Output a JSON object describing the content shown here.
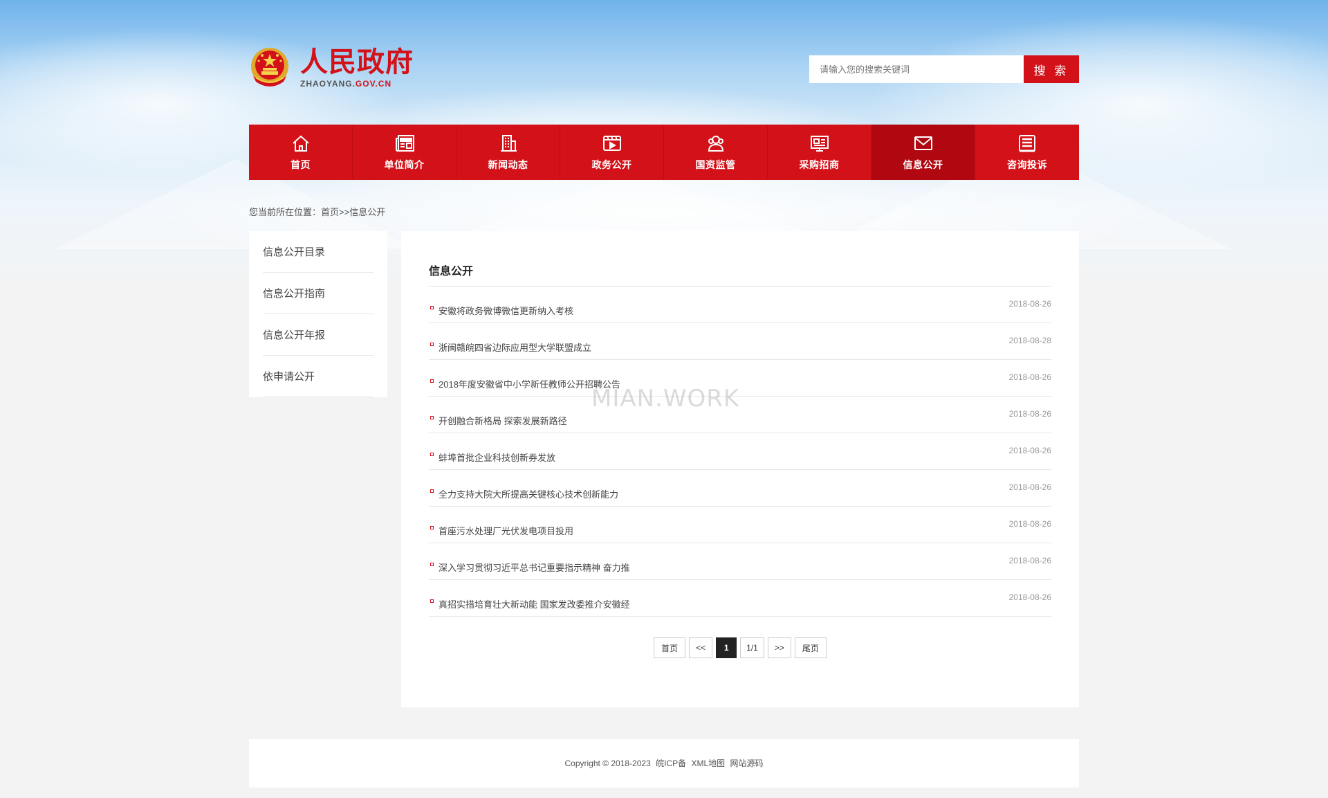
{
  "header": {
    "logo_title": "人民政府",
    "logo_domain_main": "ZHAOYANG.",
    "logo_domain_accent": "GOV.CN",
    "search_placeholder": "请输入您的搜索关键词",
    "search_button": "搜 索"
  },
  "nav": {
    "items": [
      {
        "label": "首页",
        "icon": "home-icon"
      },
      {
        "label": "单位简介",
        "icon": "news-icon"
      },
      {
        "label": "新闻动态",
        "icon": "building-icon"
      },
      {
        "label": "政务公开",
        "icon": "video-icon"
      },
      {
        "label": "国资监管",
        "icon": "users-icon"
      },
      {
        "label": "采购招商",
        "icon": "monitor-icon"
      },
      {
        "label": "信息公开",
        "icon": "mail-icon",
        "active": true
      },
      {
        "label": "咨询投诉",
        "icon": "document-icon"
      }
    ]
  },
  "breadcrumb": {
    "prefix": "您当前所在位置：",
    "home": "首页",
    "sep": ">>",
    "current": "信息公开"
  },
  "sidebar": {
    "items": [
      {
        "label": "信息公开目录"
      },
      {
        "label": "信息公开指南"
      },
      {
        "label": "信息公开年报"
      },
      {
        "label": "依申请公开"
      }
    ]
  },
  "main": {
    "title": "信息公开",
    "news": [
      {
        "title": "安徽将政务微博微信更新纳入考核",
        "date": "2018-08-26"
      },
      {
        "title": "浙闽赣皖四省边际应用型大学联盟成立",
        "date": "2018-08-28"
      },
      {
        "title": "2018年度安徽省中小学新任教师公开招聘公告",
        "date": "2018-08-26"
      },
      {
        "title": "开创融合新格局 探索发展新路径",
        "date": "2018-08-26"
      },
      {
        "title": "蚌埠首批企业科技创新券发放",
        "date": "2018-08-26"
      },
      {
        "title": "全力支持大院大所提高关键核心技术创新能力",
        "date": "2018-08-26"
      },
      {
        "title": "首座污水处理厂光伏发电项目投用",
        "date": "2018-08-26"
      },
      {
        "title": "深入学习贯彻习近平总书记重要指示精神 奋力推",
        "date": "2018-08-26"
      },
      {
        "title": "真招实措培育壮大新动能 国家发改委推介安徽经",
        "date": "2018-08-26"
      }
    ],
    "pager": {
      "first": "首页",
      "prev": "<<",
      "current": "1",
      "info": "1/1",
      "next": ">>",
      "last": "尾页"
    }
  },
  "watermark": "MIAN.WORK",
  "footer": {
    "copyright": "Copyright © 2018-2023",
    "icp": "皖ICP备",
    "sitemap": "XML地图",
    "source": "网站源码"
  },
  "colors": {
    "brand_red": "#d31119",
    "active_nav": "#b00710"
  }
}
